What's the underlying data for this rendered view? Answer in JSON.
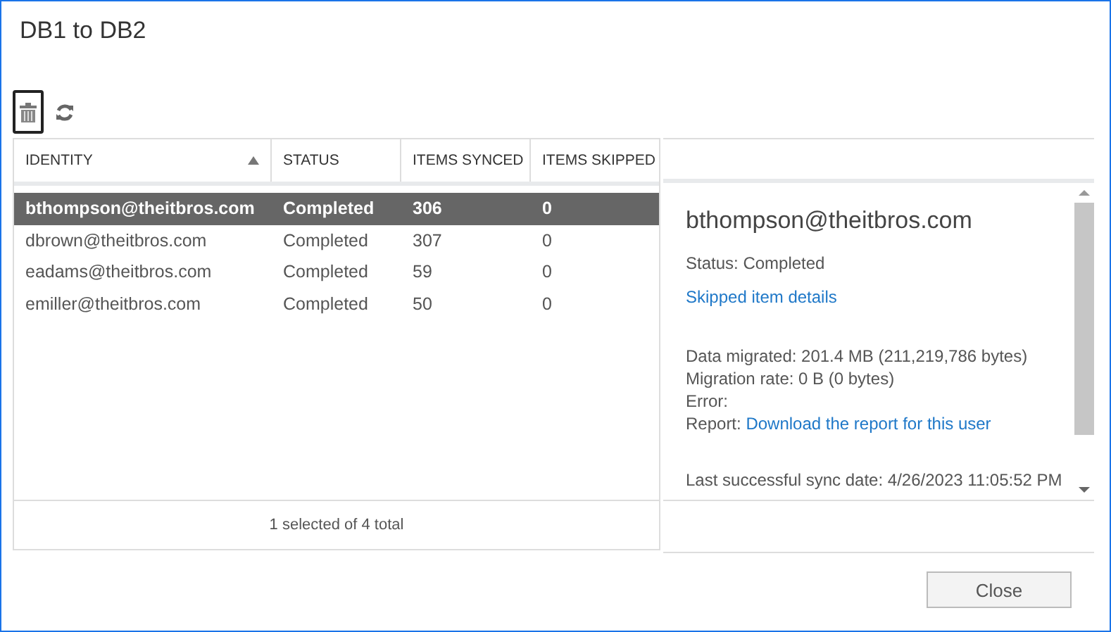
{
  "window": {
    "title": "DB1 to DB2"
  },
  "toolbar": [
    {
      "kind": "delete",
      "focused": true
    },
    {
      "kind": "refresh",
      "focused": false
    }
  ],
  "table": {
    "columns": [
      {
        "label": "IDENTITY",
        "sorted": true
      },
      {
        "label": "STATUS",
        "sorted": false
      },
      {
        "label": "ITEMS SYNCED",
        "sorted": false
      },
      {
        "label": "ITEMS SKIPPED",
        "sorted": false
      }
    ],
    "rows": [
      {
        "cells": [
          "bthompson@theitbros.com",
          "Completed",
          "306",
          "0"
        ],
        "selected": true
      },
      {
        "cells": [
          "dbrown@theitbros.com",
          "Completed",
          "307",
          "0"
        ],
        "selected": false
      },
      {
        "cells": [
          "eadams@theitbros.com",
          "Completed",
          "59",
          "0"
        ],
        "selected": false
      },
      {
        "cells": [
          "emiller@theitbros.com",
          "Completed",
          "50",
          "0"
        ],
        "selected": false
      }
    ],
    "footer": "1 selected of 4 total"
  },
  "details": {
    "title": "bthompson@theitbros.com",
    "status": "Status: Completed",
    "link": "Skipped item details",
    "lines": [
      {
        "kind": "text",
        "text": "Data migrated: 201.4 MB (211,219,786 bytes)"
      },
      {
        "kind": "text",
        "text": "Migration rate: 0 B (0 bytes)"
      },
      {
        "kind": "text",
        "text": "Error:"
      },
      {
        "kind": "link",
        "label": "Report:",
        "link": "Download the report for this user"
      }
    ],
    "last_sync": "Last successful sync date: 4/26/2023 11:05:52 PM"
  },
  "buttons": [
    {
      "label": "Close",
      "disabled": false
    }
  ]
}
